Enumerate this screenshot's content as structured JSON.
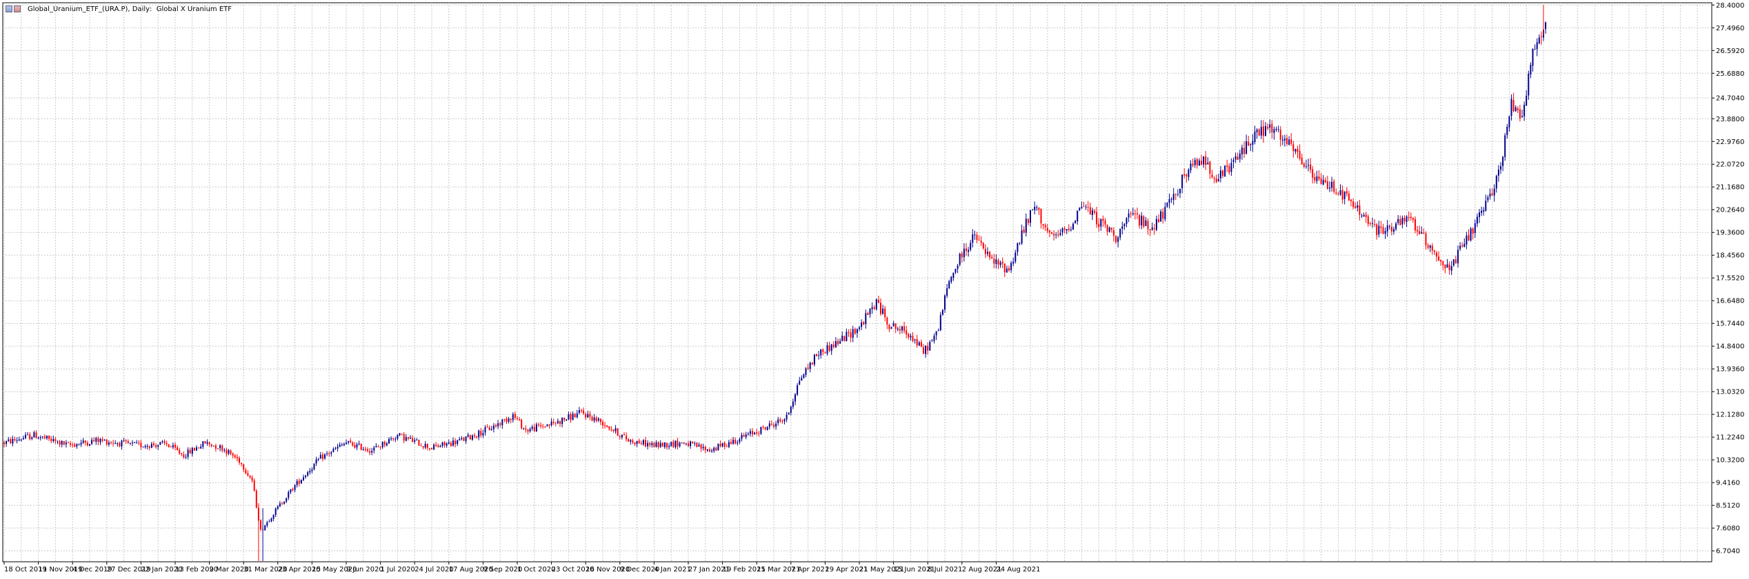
{
  "window": {
    "symbol": "Global_Uranium_ETF_(URA.P)",
    "timeframe": "Daily",
    "description": "Global X Uranium ETF"
  },
  "colors": {
    "bull": "#00008b",
    "bear": "#ff0000",
    "grid": "#c8c8c8",
    "axis": "#000000",
    "background": "#ffffff"
  },
  "chart_data": {
    "type": "candlestick",
    "y_ticks": [
      "28.4000",
      "27.4960",
      "26.5920",
      "25.6880",
      "24.7040",
      "23.8800",
      "22.9760",
      "22.0720",
      "21.1680",
      "20.2640",
      "19.3600",
      "18.4560",
      "17.5520",
      "16.6480",
      "15.7440",
      "14.8400",
      "13.9360",
      "13.0320",
      "12.1280",
      "11.2240",
      "10.3200",
      "9.4160",
      "8.5120",
      "7.6080",
      "6.7040"
    ],
    "ylim": [
      6.27,
      28.49
    ],
    "x_labels": [
      "18 Oct 2019",
      "11 Nov 2019",
      "4 Dec 2019",
      "27 Dec 2019",
      "22 Jan 2020",
      "13 Feb 2020",
      "9 Mar 2020",
      "31 Mar 2020",
      "23 Apr 2020",
      "15 May 2020",
      "9 Jun 2020",
      "1 Jul 2020",
      "24 Jul 2020",
      "17 Aug 2020",
      "9 Sep 2020",
      "1 Oct 2020",
      "23 Oct 2020",
      "16 Nov 2020",
      "9 Dec 2020",
      "4 Jan 2021",
      "27 Jan 2021",
      "19 Feb 2021",
      "15 Mar 2021",
      "7 Apr 2021",
      "29 Apr 2021",
      "21 May 2021",
      "15 Jun 2021",
      "8 Jul 2021",
      "2 Aug 2021",
      "24 Aug 2021"
    ],
    "bars_per_label": 16,
    "anchors": [
      [
        0,
        11.0
      ],
      [
        14,
        11.3
      ],
      [
        30,
        10.9
      ],
      [
        44,
        11.1
      ],
      [
        62,
        10.9
      ],
      [
        76,
        10.95
      ],
      [
        84,
        10.5
      ],
      [
        94,
        11.0
      ],
      [
        102,
        10.8
      ],
      [
        110,
        10.3
      ],
      [
        116,
        9.5
      ],
      [
        120,
        7.5
      ],
      [
        126,
        8.2
      ],
      [
        136,
        9.3
      ],
      [
        148,
        10.4
      ],
      [
        160,
        11.0
      ],
      [
        172,
        10.7
      ],
      [
        184,
        11.3
      ],
      [
        200,
        10.8
      ],
      [
        214,
        11.1
      ],
      [
        228,
        11.6
      ],
      [
        238,
        12.1
      ],
      [
        244,
        11.5
      ],
      [
        258,
        11.8
      ],
      [
        270,
        12.2
      ],
      [
        280,
        11.8
      ],
      [
        292,
        11.1
      ],
      [
        304,
        10.9
      ],
      [
        318,
        11.0
      ],
      [
        330,
        10.7
      ],
      [
        342,
        11.1
      ],
      [
        356,
        11.6
      ],
      [
        366,
        12.0
      ],
      [
        372,
        13.5
      ],
      [
        380,
        14.5
      ],
      [
        390,
        15.0
      ],
      [
        400,
        15.6
      ],
      [
        408,
        16.6
      ],
      [
        414,
        15.7
      ],
      [
        424,
        15.3
      ],
      [
        430,
        14.6
      ],
      [
        436,
        15.3
      ],
      [
        442,
        17.4
      ],
      [
        448,
        18.5
      ],
      [
        454,
        19.2
      ],
      [
        462,
        18.2
      ],
      [
        470,
        17.9
      ],
      [
        476,
        19.3
      ],
      [
        482,
        20.4
      ],
      [
        490,
        19.1
      ],
      [
        498,
        19.5
      ],
      [
        504,
        20.5
      ],
      [
        512,
        19.8
      ],
      [
        520,
        19.2
      ],
      [
        528,
        20.1
      ],
      [
        536,
        19.5
      ],
      [
        544,
        20.3
      ],
      [
        552,
        21.6
      ],
      [
        560,
        22.3
      ],
      [
        568,
        21.5
      ],
      [
        576,
        22.2
      ],
      [
        584,
        23.2
      ],
      [
        592,
        23.5
      ],
      [
        600,
        22.9
      ],
      [
        608,
        22.1
      ],
      [
        614,
        21.4
      ],
      [
        622,
        21.2
      ],
      [
        628,
        20.7
      ],
      [
        636,
        20.0
      ],
      [
        642,
        19.4
      ],
      [
        650,
        19.6
      ],
      [
        658,
        19.9
      ],
      [
        664,
        19.1
      ],
      [
        670,
        18.5
      ],
      [
        676,
        17.8
      ],
      [
        682,
        18.8
      ],
      [
        688,
        19.6
      ],
      [
        694,
        20.6
      ],
      [
        700,
        22.0
      ],
      [
        705,
        24.5
      ],
      [
        710,
        24.1
      ],
      [
        715,
        26.5
      ],
      [
        720,
        27.5
      ]
    ],
    "bar_count": 722
  }
}
